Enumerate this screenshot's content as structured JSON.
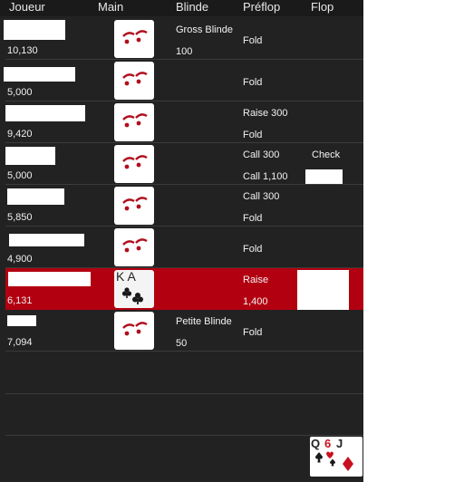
{
  "header": {
    "joueur": "Joueur",
    "main": "Main",
    "blinde": "Blinde",
    "preflop": "Préflop",
    "flop": "Flop"
  },
  "rows": [
    {
      "stack": "10,130",
      "hand": "card-back",
      "blind_label": "Gross Blinde",
      "blind_amount": "100",
      "pre1": "Fold",
      "pre2": "",
      "flop": ""
    },
    {
      "stack": "5,000",
      "hand": "card-back",
      "blind_label": "",
      "blind_amount": "",
      "pre1": "Fold",
      "pre2": "",
      "flop": ""
    },
    {
      "stack": "9,420",
      "hand": "card-back",
      "blind_label": "",
      "blind_amount": "",
      "pre1": "Raise 300",
      "pre2": "Fold",
      "flop": ""
    },
    {
      "stack": "5,000",
      "hand": "card-back",
      "blind_label": "",
      "blind_amount": "",
      "pre1": "Call 300",
      "pre2": "Call 1,100",
      "flop": "Check"
    },
    {
      "stack": "5,850",
      "hand": "card-back",
      "blind_label": "",
      "blind_amount": "",
      "pre1": "Call 300",
      "pre2": "Fold",
      "flop": ""
    },
    {
      "stack": "4,900",
      "hand": "card-back",
      "blind_label": "",
      "blind_amount": "",
      "pre1": "Fold",
      "pre2": "",
      "flop": ""
    },
    {
      "stack": "6,131",
      "hand": "KA clubs",
      "hand_ranks": "K A",
      "blind_label": "",
      "blind_amount": "",
      "pre1": "Raise",
      "pre2": "1,400",
      "flop": ""
    },
    {
      "stack": "7,094",
      "hand": "card-back",
      "blind_label": "Petite Blinde",
      "blind_amount": "50",
      "pre1": "Fold",
      "pre2": "",
      "flop": ""
    }
  ],
  "board": {
    "cards": [
      "Q",
      "6",
      "J"
    ],
    "suits": [
      "spades",
      "hearts",
      "diamonds"
    ]
  },
  "colors": {
    "panel": "#222222",
    "highlight": "#b20010",
    "card_logo": "#b0101e"
  }
}
